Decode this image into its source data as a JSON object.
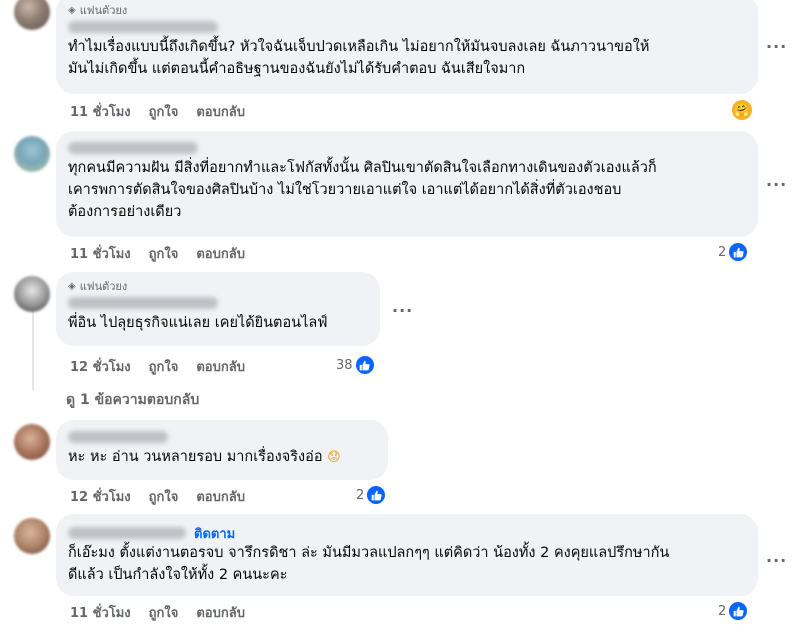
{
  "comments": [
    {
      "badge": "แฟนตัวยง",
      "text_lines": [
        "ทำไมเรื่องแบบนี้ถึงเกิดขึ้น? หัวใจฉันเจ็บปวดเหลือเกิน ไม่อยากให้มันจบลงเลย ฉันภาวนาขอให้",
        "มันไม่เกิดขึ้น แต่ตอนนี้คำอธิษฐานของฉันยังไม่ได้รับคำตอบ ฉันเสียใจมาก"
      ],
      "time": "11 ชั่วโมง",
      "like": "ถูกใจ",
      "reply": "ตอบกลับ",
      "reaction": "hug-emoji"
    },
    {
      "text_lines": [
        "ทุกคนมีความฝัน มีสิ่งที่อยากทำและโฟกัสทั้งนั้น ศิลปินเขาตัดสินใจเลือกทางเดินของตัวเองแล้วก็",
        "เคารพการตัดสินใจของศิลปินบ้าง ไม่ใช่โวยวายเอาแต่ใจ เอาแต่ได้อยากได้สิ่งที่ตัวเองชอบ",
        "ต้องการอย่างเดียว"
      ],
      "time": "11 ชั่วโมง",
      "like": "ถูกใจ",
      "reply": "ตอบกลับ",
      "reaction_count": "2"
    },
    {
      "badge": "แฟนตัวยง",
      "text_lines": [
        "พี่อิน ไปลุยธุรกิจแน่เลย เคยได้ยินตอนไลฟ์"
      ],
      "time": "12 ชั่วโมง",
      "like": "ถูกใจ",
      "reply": "ตอบกลับ",
      "reaction_count": "38"
    },
    {
      "text_lines": [
        "หะ หะ อ่าน วนหลายรอบ มากเรื่องจริงอ่อ"
      ],
      "time": "12 ชั่วโมง",
      "like": "ถูกใจ",
      "reply": "ตอบกลับ",
      "reaction_count": "2"
    },
    {
      "follow": "ติดตาม",
      "text_lines": [
        "ก็เอ๊ะมง ตั้งแต่งานตอรจบ จารึกรดิชา ล่ะ มันมีมวลแปลกๆๆ แต่คิดว่า น้องทั้ง 2 คงคุยแลปรึกษากัน",
        "ดีแล้ว เป็นกำลังใจให้ทั้ง 2 คนนะคะ"
      ],
      "time": "11 ชั่วโมง",
      "like": "ถูกใจ",
      "reply": "ตอบกลับ",
      "reaction_count": "2"
    }
  ],
  "view_replies": "ดู 1 ข้อความตอบกลับ",
  "more_label": "···",
  "colors": {
    "accent": "#0866ff",
    "bubble": "#f0f2f5",
    "meta": "#65676b"
  }
}
